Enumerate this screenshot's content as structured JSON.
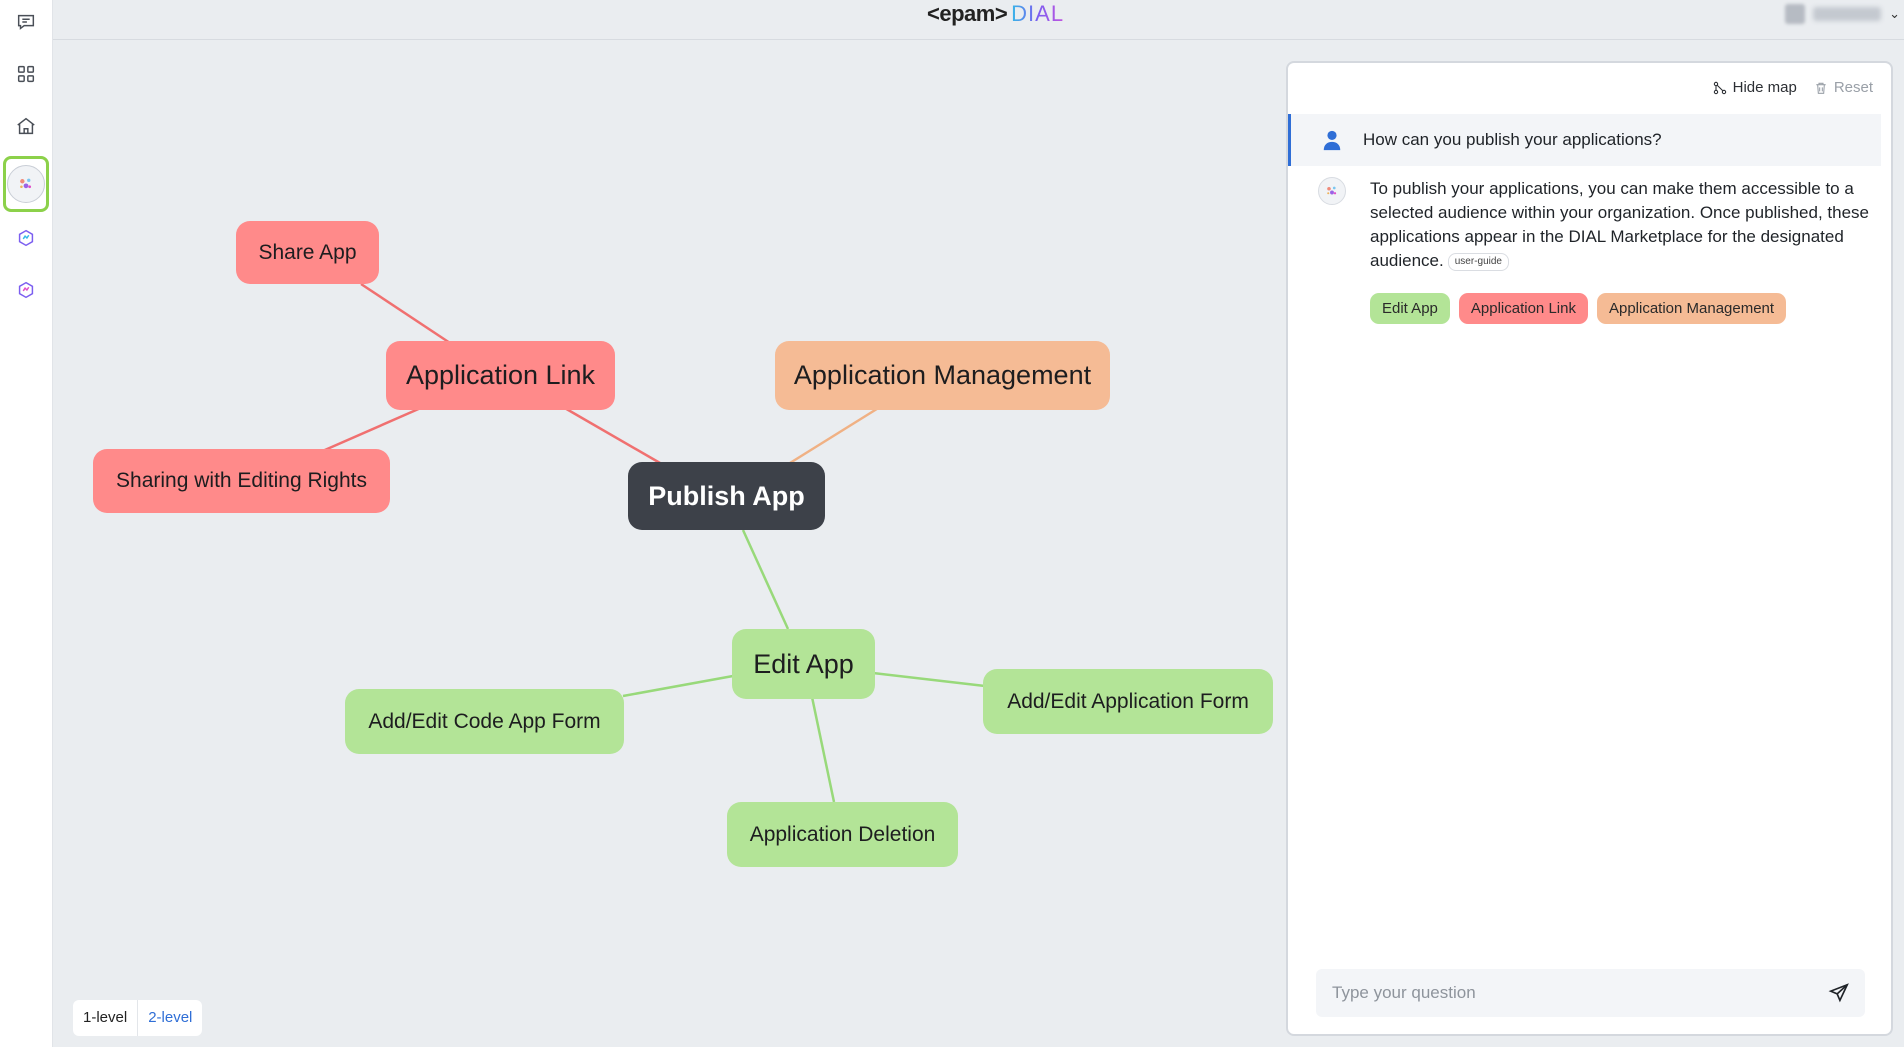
{
  "header": {
    "logo_epam": "<epam>",
    "logo_dial": "DIAL",
    "user_chevron": "⌄"
  },
  "sidebar": {
    "items": [
      {
        "icon": "chat-icon"
      },
      {
        "icon": "apps-grid-icon"
      },
      {
        "icon": "home-icon"
      },
      {
        "icon": "mindmap-app-icon",
        "active": true
      },
      {
        "icon": "assistant-app-icon"
      },
      {
        "icon": "assistant-app-icon-2"
      }
    ]
  },
  "mindmap": {
    "center": "Publish App",
    "nodes": {
      "share_app": "Share App",
      "application_link": "Application Link",
      "sharing_editing": "Sharing with Editing Rights",
      "application_management": "Application Management",
      "edit_app": "Edit App",
      "add_edit_code_app_form": "Add/Edit Code App Form",
      "add_edit_application_form": "Add/Edit Application Form",
      "application_deletion": "Application Deletion"
    },
    "colors": {
      "red": "#ff8a8a",
      "orange": "#f5bb95",
      "green": "#b3e497",
      "center": "#3d4149",
      "red_link": "#f07070",
      "orange_link": "#f0b184",
      "green_link": "#98d97a"
    },
    "levels": {
      "level1": "1-level",
      "level2": "2-level",
      "selected": "2-level"
    }
  },
  "chat": {
    "hide_map": "Hide map",
    "reset": "Reset",
    "user_message": "How can you publish your applications?",
    "bot_message": "To publish your applications, you can make them accessible to a selected audience within your organization. Once published, these applications appear in the DIAL Marketplace for the designated audience.",
    "reference_tag": "user-guide",
    "tags": [
      {
        "label": "Edit App",
        "color": "green"
      },
      {
        "label": "Application Link",
        "color": "red"
      },
      {
        "label": "Application Management",
        "color": "orange"
      }
    ],
    "input_placeholder": "Type your question",
    "accent": "#2f6ed6"
  }
}
